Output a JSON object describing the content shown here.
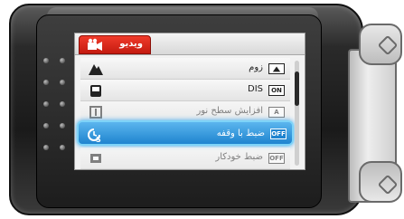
{
  "menu": {
    "tab": {
      "label": "ویدیو",
      "icon": "video-camera-icon"
    },
    "items": [
      {
        "label": "زوم",
        "icon": "zoom-mountain-icon",
        "value_icon": "zoom-setting-icon",
        "value": "",
        "state": "normal"
      },
      {
        "label": "DIS",
        "icon": "dis-hand-icon",
        "value_icon": "on-badge-icon",
        "value": "ON",
        "state": "normal"
      },
      {
        "label": "افزایش سطح نور",
        "icon": "gain-up-icon",
        "value_icon": "auto-badge-icon",
        "value": "A",
        "state": "faded"
      },
      {
        "label": "ضبط با وقفه",
        "icon": "time-lapse-icon",
        "value_icon": "off-badge-icon",
        "value": "OFF",
        "state": "selected"
      },
      {
        "label": "ضبط خودکار",
        "icon": "auto-rec-icon",
        "value_icon": "off-badge-icon",
        "value": "OFF",
        "state": "faded"
      }
    ],
    "scroll_position": 0.15
  },
  "colors": {
    "tab": "#d8261a",
    "selection": "#2d93da",
    "selection_glow": "#7ed3f8"
  }
}
